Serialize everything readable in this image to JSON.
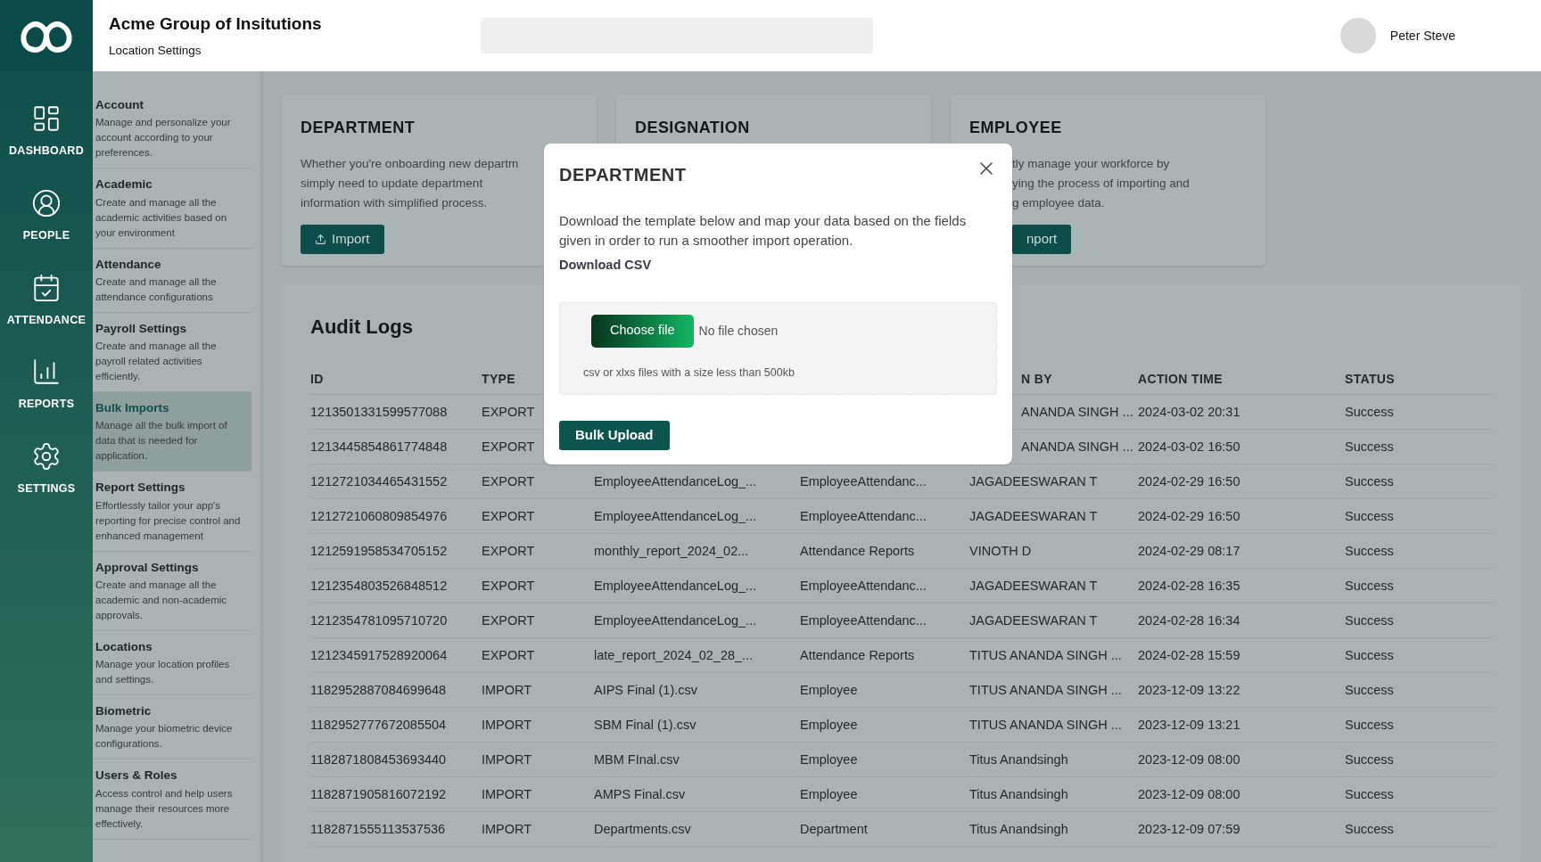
{
  "header": {
    "title": "Acme Group of Insitutions",
    "subtitle": "Location Settings",
    "user": {
      "name": "Peter Steve"
    }
  },
  "nav": [
    {
      "label": "DASHBOARD"
    },
    {
      "label": "PEOPLE"
    },
    {
      "label": "ATTENDANCE"
    },
    {
      "label": "REPORTS"
    },
    {
      "label": "SETTINGS"
    }
  ],
  "settings_menu": [
    {
      "title": "Account",
      "description": "Manage and personalize your account according to your preferences.",
      "selected": false
    },
    {
      "title": "Academic",
      "description": "Create and manage all the academic activities based on your environment",
      "selected": false
    },
    {
      "title": "Attendance",
      "description": "Create and manage all the attendance configurations",
      "selected": false
    },
    {
      "title": "Payroll Settings",
      "description": "Create and manage all the payroll related activities efficiently.",
      "selected": false
    },
    {
      "title": "Bulk Imports",
      "description": "Manage all the bulk import of data that is needed for application.",
      "selected": true
    },
    {
      "title": "Report Settings",
      "description": "Effortlessly tailor your app's reporting for precise control and enhanced management",
      "selected": false
    },
    {
      "title": "Approval Settings",
      "description": "Create and manage all the academic and non-academic approvals.",
      "selected": false
    },
    {
      "title": "Locations",
      "description": "Manage your location profiles and settings.",
      "selected": false
    },
    {
      "title": "Biometric",
      "description": "Manage your biometric device configurations.",
      "selected": false
    },
    {
      "title": "Users & Roles",
      "description": "Access control and help users manage their resources more effectively.",
      "selected": false
    }
  ],
  "import_cards": [
    {
      "title": "DEPARTMENT",
      "description": "Whether you're onboarding new departm\nsimply need to update department\ninformation with simplified process.",
      "button": "Import"
    },
    {
      "title": "DESIGNATION"
    },
    {
      "title": "EMPLOYEE",
      "description": "tly manage your workforce by\nying the process of importing and\ng employee data.",
      "button": "nport"
    }
  ],
  "audit_logs": {
    "title": "Audit Logs",
    "columns": [
      "ID",
      "TYPE",
      "N BY",
      "ACTION TIME",
      "STATUS"
    ],
    "rows": [
      {
        "id": "1213501331599577088",
        "type": "EXPORT",
        "by": "ANANDA SINGH ...",
        "time": "2024-03-02 20:31",
        "status": "Success"
      },
      {
        "id": "1213445854861774848",
        "type": "EXPORT",
        "by": "ANANDA SINGH ...",
        "time": "2024-03-02 16:50",
        "status": "Success"
      },
      {
        "id": "1212721034465431552",
        "type": "EXPORT",
        "file": "EmployeeAttendanceLog_...",
        "module": "EmployeeAttendanc...",
        "by": "JAGADEESWARAN T",
        "time": "2024-02-29 16:50",
        "status": "Success"
      },
      {
        "id": "1212721060809854976",
        "type": "EXPORT",
        "file": "EmployeeAttendanceLog_...",
        "module": "EmployeeAttendanc...",
        "by": "JAGADEESWARAN T",
        "time": "2024-02-29 16:50",
        "status": "Success"
      },
      {
        "id": "1212591958534705152",
        "type": "EXPORT",
        "file": "monthly_report_2024_02...",
        "module": "Attendance Reports",
        "by": "VINOTH D",
        "time": "2024-02-29 08:17",
        "status": "Success"
      },
      {
        "id": "1212354803526848512",
        "type": "EXPORT",
        "file": "EmployeeAttendanceLog_...",
        "module": "EmployeeAttendanc...",
        "by": "JAGADEESWARAN T",
        "time": "2024-02-28 16:35",
        "status": "Success"
      },
      {
        "id": "1212354781095710720",
        "type": "EXPORT",
        "file": "EmployeeAttendanceLog_...",
        "module": "EmployeeAttendanc...",
        "by": "JAGADEESWARAN T",
        "time": "2024-02-28 16:34",
        "status": "Success"
      },
      {
        "id": "1212345917528920064",
        "type": "EXPORT",
        "file": "late_report_2024_02_28_...",
        "module": "Attendance Reports",
        "by": "TITUS ANANDA SINGH ...",
        "time": "2024-02-28 15:59",
        "status": "Success"
      },
      {
        "id": "1182952887084699648",
        "type": "IMPORT",
        "file": "AIPS Final (1).csv",
        "module": "Employee",
        "by": "TITUS ANANDA SINGH ...",
        "time": "2023-12-09 13:22",
        "status": "Success"
      },
      {
        "id": "1182952777672085504",
        "type": "IMPORT",
        "file": "SBM Final (1).csv",
        "module": "Employee",
        "by": "TITUS ANANDA SINGH ...",
        "time": "2023-12-09 13:21",
        "status": "Success"
      },
      {
        "id": "1182871808453693440",
        "type": "IMPORT",
        "file": "MBM FInal.csv",
        "module": "Employee",
        "by": "Titus Anandsingh",
        "time": "2023-12-09 08:00",
        "status": "Success"
      },
      {
        "id": "1182871905816072192",
        "type": "IMPORT",
        "file": "AMPS Final.csv",
        "module": "Employee",
        "by": "Titus Anandsingh",
        "time": "2023-12-09 08:00",
        "status": "Success"
      },
      {
        "id": "1182871555113537536",
        "type": "IMPORT",
        "file": "Departments.csv",
        "module": "Department",
        "by": "Titus Anandsingh",
        "time": "2023-12-09 07:59",
        "status": "Success"
      }
    ]
  },
  "modal": {
    "title": "DEPARTMENT",
    "text": "Download the template below and map your data based on the fields given in order to run a smoother import operation.",
    "link": "Download CSV",
    "file_button": "Choose file",
    "file_status": "No file chosen",
    "hint": "csv or xlxs files with a size less than 500kb",
    "submit": "Bulk Upload"
  }
}
